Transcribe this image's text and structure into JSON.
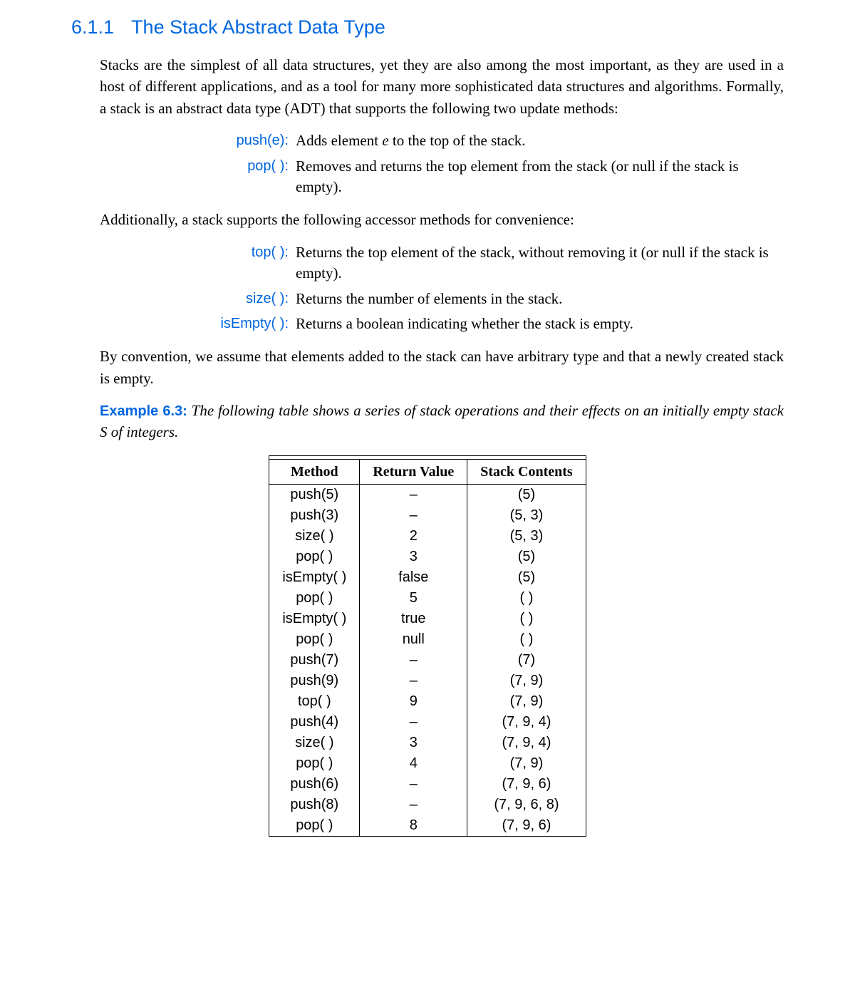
{
  "heading": {
    "number": "6.1.1",
    "title": "The Stack Abstract Data Type"
  },
  "para1": "Stacks are the simplest of all data structures, yet they are also among the most important, as they are used in a host of different applications, and as a tool for many more sophisticated data structures and algorithms. Formally, a stack is an abstract data type (ADT) that supports the following two update methods:",
  "update_methods": [
    {
      "name": "push(e):",
      "desc_html": "Adds element <span class=\"italic-e\">e</span> to the top of the stack."
    },
    {
      "name": "pop( ):",
      "desc_html": "Removes and returns the top element from the stack (or null if the stack is empty)."
    }
  ],
  "para2": "Additionally, a stack supports the following accessor methods for convenience:",
  "accessor_methods": [
    {
      "name": "top( ):",
      "desc_html": "Returns the top element of the stack, without removing it (or null if the stack is empty)."
    },
    {
      "name": "size( ):",
      "desc_html": "Returns the number of elements in the stack."
    },
    {
      "name": "isEmpty( ):",
      "desc_html": "Returns a boolean indicating whether the stack is empty."
    }
  ],
  "para3": "By convention, we assume that elements added to the stack can have arbitrary type and that a newly created stack is empty.",
  "example": {
    "label": "Example 6.3:",
    "text": "The following table shows a series of stack operations and their effects on an initially empty stack S of integers."
  },
  "table": {
    "headers": [
      "Method",
      "Return Value",
      "Stack Contents"
    ],
    "rows": [
      [
        "push(5)",
        "–",
        "(5)"
      ],
      [
        "push(3)",
        "–",
        "(5, 3)"
      ],
      [
        "size( )",
        "2",
        "(5, 3)"
      ],
      [
        "pop( )",
        "3",
        "(5)"
      ],
      [
        "isEmpty( )",
        "false",
        "(5)"
      ],
      [
        "pop( )",
        "5",
        "( )"
      ],
      [
        "isEmpty( )",
        "true",
        "( )"
      ],
      [
        "pop( )",
        "null",
        "( )"
      ],
      [
        "push(7)",
        "–",
        "(7)"
      ],
      [
        "push(9)",
        "–",
        "(7, 9)"
      ],
      [
        "top( )",
        "9",
        "(7, 9)"
      ],
      [
        "push(4)",
        "–",
        "(7, 9, 4)"
      ],
      [
        "size( )",
        "3",
        "(7, 9, 4)"
      ],
      [
        "pop( )",
        "4",
        "(7, 9)"
      ],
      [
        "push(6)",
        "–",
        "(7, 9, 6)"
      ],
      [
        "push(8)",
        "–",
        "(7, 9, 6, 8)"
      ],
      [
        "pop( )",
        "8",
        "(7, 9, 6)"
      ]
    ]
  }
}
